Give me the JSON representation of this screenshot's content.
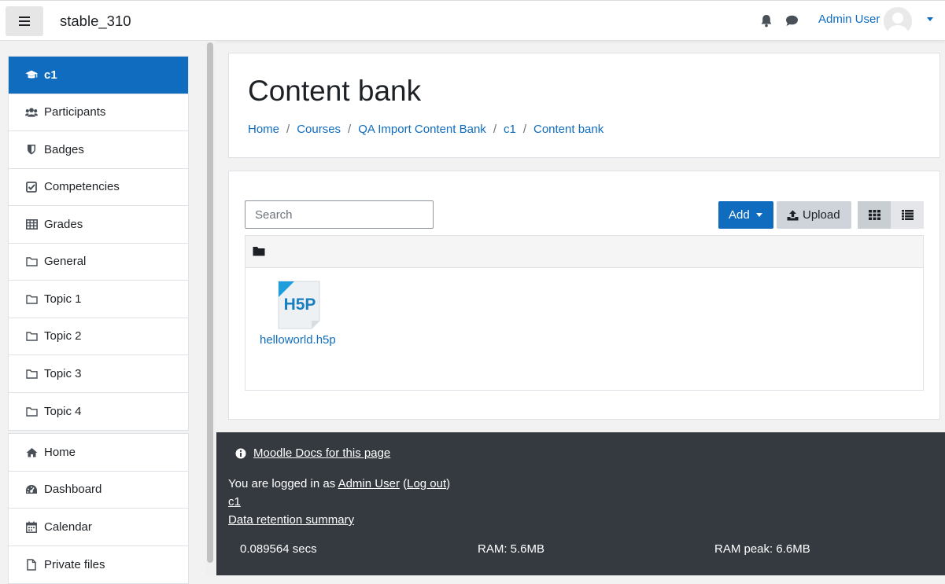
{
  "navbar": {
    "site_name": "stable_310",
    "user_name": "Admin User",
    "icons": [
      "hamburger-icon",
      "bell-icon",
      "chat-icon",
      "avatar",
      "chevron-down-icon"
    ]
  },
  "sidebar": {
    "course_items": [
      {
        "label": "c1",
        "icon": "graduation-cap-icon",
        "active": true
      },
      {
        "label": "Participants",
        "icon": "users-icon"
      },
      {
        "label": "Badges",
        "icon": "shield-icon"
      },
      {
        "label": "Competencies",
        "icon": "check-square-icon"
      },
      {
        "label": "Grades",
        "icon": "table-icon"
      },
      {
        "label": "General",
        "icon": "folder-icon"
      },
      {
        "label": "Topic 1",
        "icon": "folder-icon"
      },
      {
        "label": "Topic 2",
        "icon": "folder-icon"
      },
      {
        "label": "Topic 3",
        "icon": "folder-icon"
      },
      {
        "label": "Topic 4",
        "icon": "folder-icon"
      }
    ],
    "site_items": [
      {
        "label": "Home",
        "icon": "home-icon"
      },
      {
        "label": "Dashboard",
        "icon": "dashboard-icon"
      },
      {
        "label": "Calendar",
        "icon": "calendar-icon"
      },
      {
        "label": "Private files",
        "icon": "file-icon"
      }
    ]
  },
  "header": {
    "title": "Content bank",
    "breadcrumb": [
      "Home",
      "Courses",
      "QA Import Content Bank",
      "c1",
      "Content bank"
    ],
    "separator": "/"
  },
  "content": {
    "search_placeholder": "Search",
    "add_label": "Add",
    "upload_label": "Upload",
    "files": [
      {
        "name": "helloworld.h5p",
        "icon": "h5p-file-icon"
      }
    ]
  },
  "footer": {
    "docs_link": "Moodle Docs for this page",
    "logged_in_prefix": "You are logged in as",
    "user_link": "Admin User",
    "logout_link": "Log out",
    "course_link": "c1",
    "retention_link": "Data retention summary",
    "perf_time": "0.089564 secs",
    "perf_ram": "RAM: 5.6MB",
    "perf_ram_peak": "RAM peak: 6.6MB"
  },
  "colors": {
    "primary": "#0f6cbf",
    "footer_bg": "#343a40",
    "active_nav": "#0f6cbf"
  }
}
